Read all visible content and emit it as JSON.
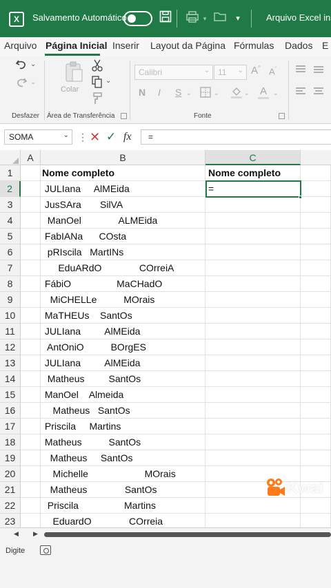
{
  "titlebar": {
    "logo_letter": "X",
    "autosave_label": "Salvamento Automático",
    "autosave_on": false,
    "file_title": "Arquivo Excel inst"
  },
  "tabs": [
    {
      "label": "Arquivo",
      "active": false
    },
    {
      "label": "Página Inicial",
      "active": true
    },
    {
      "label": "Inserir",
      "active": false
    },
    {
      "label": "Layout da Página",
      "active": false
    },
    {
      "label": "Fórmulas",
      "active": false
    },
    {
      "label": "Dados",
      "active": false
    },
    {
      "label": "E",
      "active": false
    }
  ],
  "ribbon": {
    "undo_group_label": "Desfazer",
    "clipboard_group_label": "Área de Transferência",
    "paste_label": "Colar",
    "font_group_label": "Fonte",
    "font_name": "Calibri",
    "font_size": "11",
    "grow_font": "A",
    "shrink_font": "A",
    "bold": "N",
    "italic": "I",
    "underline": "S",
    "font_color_letter": "A"
  },
  "formula_bar": {
    "name_box": "SOMA",
    "formula": "=",
    "fx": "fx"
  },
  "columns": [
    "A",
    "B",
    "C"
  ],
  "selected_column": "C",
  "selected_row": 2,
  "rows": [
    {
      "num": "1",
      "b": "Nome completo",
      "c": "Nome completo",
      "bold": true
    },
    {
      "num": "2",
      "b": " JULIana     AlMEida",
      "c": "="
    },
    {
      "num": "3",
      "b": " JusSAra       SilVA",
      "c": ""
    },
    {
      "num": "4",
      "b": "  ManOel              ALMEida",
      "c": ""
    },
    {
      "num": "5",
      "b": " FabIANa      COsta",
      "c": ""
    },
    {
      "num": "6",
      "b": "  pRIscila   MartINs",
      "c": ""
    },
    {
      "num": "7",
      "b": "      EduARdO              COrreiA",
      "c": ""
    },
    {
      "num": "8",
      "b": " FábiO                 MaCHadO",
      "c": ""
    },
    {
      "num": "9",
      "b": "   MiCHELLe          MOrais",
      "c": ""
    },
    {
      "num": "10",
      "b": " MaTHEUs    SantOs",
      "c": ""
    },
    {
      "num": "11",
      "b": " JULIana         AlMEida",
      "c": ""
    },
    {
      "num": "12",
      "b": "  AntOniO          BOrgES",
      "c": ""
    },
    {
      "num": "13",
      "b": " JULIana         AlMEida",
      "c": ""
    },
    {
      "num": "14",
      "b": "  Matheus         SantOs",
      "c": ""
    },
    {
      "num": "15",
      "b": " ManOel    Almeida",
      "c": ""
    },
    {
      "num": "16",
      "b": "    Matheus   SantOs",
      "c": ""
    },
    {
      "num": "17",
      "b": " Priscila     Martins",
      "c": ""
    },
    {
      "num": "18",
      "b": " Matheus          SantOs",
      "c": ""
    },
    {
      "num": "19",
      "b": "   Matheus     SantOs",
      "c": ""
    },
    {
      "num": "20",
      "b": "    Michelle                     MOrais",
      "c": ""
    },
    {
      "num": "21",
      "b": "   Matheus              SantOs",
      "c": ""
    },
    {
      "num": "22",
      "b": "  Priscila                 Martins",
      "c": ""
    },
    {
      "num": "23",
      "b": "    EduardO              COrreia",
      "c": ""
    }
  ],
  "status": {
    "mode": "Digite"
  },
  "watermark": {
    "text": "Kwai"
  },
  "colors": {
    "excel_green": "#1f7a45",
    "watermark_orange": "#ff7a1a"
  }
}
